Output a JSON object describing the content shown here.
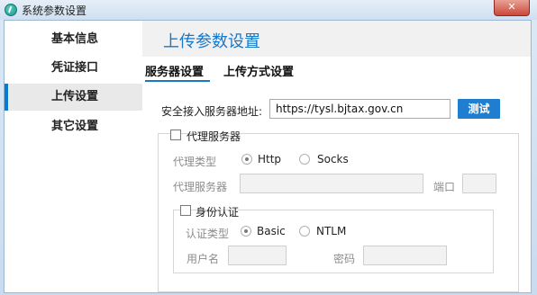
{
  "window": {
    "title": "系统参数设置",
    "close_label": "✕"
  },
  "sidebar": {
    "items": [
      {
        "label": "基本信息",
        "active": false
      },
      {
        "label": "凭证接口",
        "active": false
      },
      {
        "label": "上传设置",
        "active": true
      },
      {
        "label": "其它设置",
        "active": false
      }
    ]
  },
  "main": {
    "title": "上传参数设置",
    "tabs": [
      {
        "label": "服务器设置",
        "active": true
      },
      {
        "label": "上传方式设置",
        "active": false
      }
    ],
    "server": {
      "label": "安全接入服务器地址:",
      "value": "https://tysl.bjtax.gov.cn",
      "test_button": "测试"
    },
    "proxy": {
      "checkbox_label": "代理服务器",
      "checked": false,
      "type_label": "代理类型",
      "type_options": [
        {
          "label": "Http",
          "selected": true
        },
        {
          "label": "Socks",
          "selected": false
        }
      ],
      "server_label": "代理服务器",
      "server_value": "",
      "port_label": "端口",
      "port_value": ""
    },
    "auth": {
      "checkbox_label": "身份认证",
      "checked": false,
      "type_label": "认证类型",
      "type_options": [
        {
          "label": "Basic",
          "selected": true
        },
        {
          "label": "NTLM",
          "selected": false
        }
      ],
      "username_label": "用户名",
      "username_value": "",
      "password_label": "密码",
      "password_value": ""
    }
  },
  "colors": {
    "accent": "#1778c7",
    "button": "#1f7ed0",
    "active_nav_bar": "#0a7acc"
  }
}
